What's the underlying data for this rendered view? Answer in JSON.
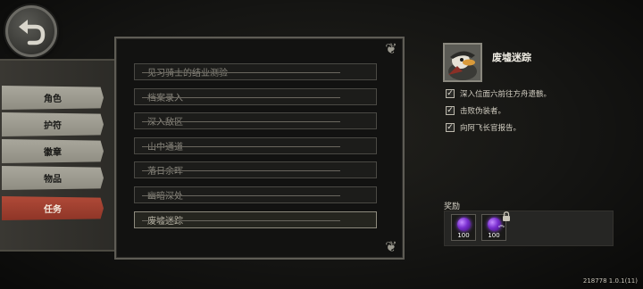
{
  "sidebar": {
    "tabs": [
      {
        "label": "角色",
        "active": false
      },
      {
        "label": "护符",
        "active": false
      },
      {
        "label": "徽章",
        "active": false
      },
      {
        "label": "物品",
        "active": false
      },
      {
        "label": "任务",
        "active": true
      }
    ]
  },
  "quests": [
    {
      "label": "见习骑士的结业测验",
      "completed": true
    },
    {
      "label": "档案录入",
      "completed": true
    },
    {
      "label": "深入敌区",
      "completed": true
    },
    {
      "label": "山中通道",
      "completed": true
    },
    {
      "label": "落日余晖",
      "completed": true
    },
    {
      "label": "幽暗深处",
      "completed": true
    },
    {
      "label": "废墟迷踪",
      "completed": true,
      "selected": true
    }
  ],
  "detail": {
    "title": "废墟迷踪",
    "objectives": [
      {
        "text": "深入位面六前往方舟遗骸。",
        "checked": true
      },
      {
        "text": "击败伪装者。",
        "checked": true
      },
      {
        "text": "向阿飞长官报告。",
        "checked": true
      }
    ],
    "rewards_label": "奖励",
    "rewards": [
      {
        "icon": "purple-gem-icon",
        "count": "100",
        "locked": false
      },
      {
        "icon": "purple-gem-upgrade-icon",
        "count": "100",
        "locked": true
      }
    ]
  },
  "version": "218778 1.0.1(11)",
  "colors": {
    "active_tab": "#a8402f",
    "tab": "#9e9c91",
    "panel_border": "#5e5c55",
    "gem": "#8a3ce0"
  }
}
